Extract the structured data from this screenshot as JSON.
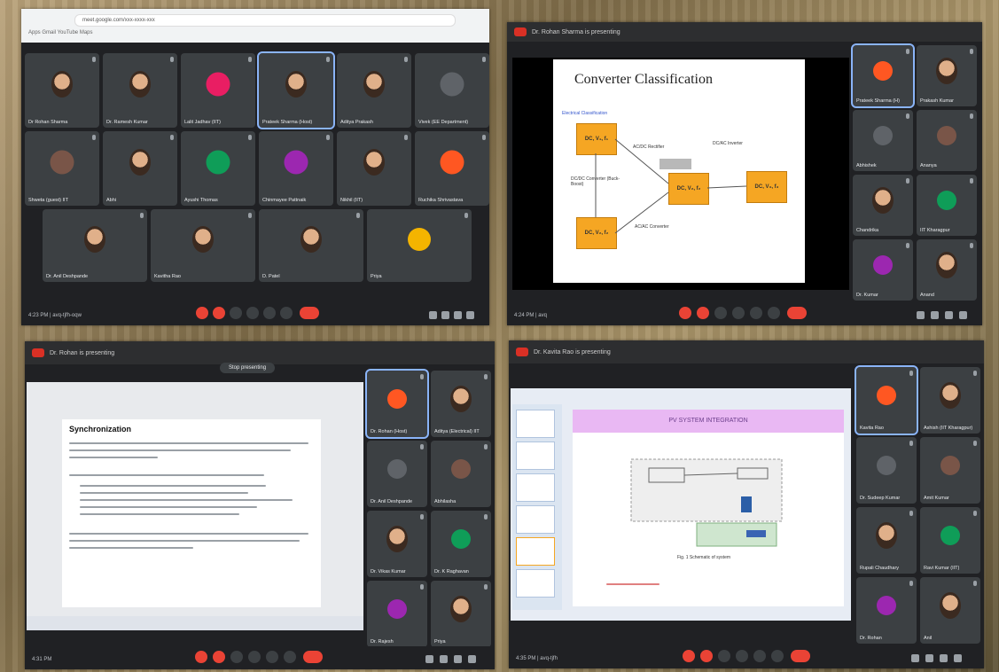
{
  "panel1": {
    "url": "meet.google.com/xxx-xxxx-xxx",
    "bookmarks": "Apps   Gmail   YouTube   Maps",
    "participants": [
      "Dr Rohan Sharma",
      "Dr. Ramesh Kumar",
      "Lalit Jadhav (IIT)",
      "Prateek Sharma (Host)",
      "Aditya Prakash",
      "Vivek (EE Department)",
      "Shweta (guest) IIT",
      "Abhi",
      "Ayushi Thomas",
      "Chinmayee Pattnaik",
      "Nikhil (IIT)",
      "Ruchika Shrivastava",
      "Dr. Anil Deshpande",
      "Kavitha Rao",
      "D. Patel",
      "Priya"
    ],
    "meeting_time": "4:23 PM | avq-tjfh-oqw"
  },
  "panel2": {
    "title": "Dr. Rohan Sharma is presenting",
    "slide_title": "Converter Classification",
    "slide_subtitle": "Electrical Classification",
    "blocks": [
      "DC, V₁, f₁",
      "DC, V₂, f₂",
      "DC, V₂, f₂",
      "DC, V₃, f₃"
    ],
    "labels": [
      "AC/DC Rectifier",
      "DC/DC Converter (Buck-Boost)",
      "DC/AC Inverter",
      "AC/AC Converter",
      "Inverter"
    ],
    "participants": [
      "Prateek Sharma (H)",
      "Prakash Kumar",
      "Abhishek",
      "Ananya",
      "Chandrika",
      "IIT Kharagpur",
      "Dr. Kumar",
      "Anand"
    ],
    "meeting_time": "4:24 PM | avq"
  },
  "panel3": {
    "title": "Dr. Rohan is presenting",
    "present_hint": "Stop presenting",
    "doc_heading": "Synchronization",
    "participants": [
      "Dr. Rohan (Host)",
      "Aditya (Electrical) IIT",
      "Dr. Anil Deshpande",
      "Abhilasha",
      "Dr. Vikas Kumar",
      "Dr. K Raghavan",
      "Dr. Rajesh",
      "Priya"
    ],
    "meeting_time": "4:31 PM"
  },
  "panel4": {
    "title": "Dr. Kavita Rao is presenting",
    "slide_banner": "PV SYSTEM INTEGRATION",
    "figure_caption": "Fig. 1 Schematic of system",
    "participants": [
      "Kavita Rao",
      "Ashish (IIT Kharagpur)",
      "Dr. Sudeep Kumar",
      "Amit Kumar",
      "Rupali Chaudhary",
      "Ravi Kumar (IIT)",
      "Dr. Rohan",
      "Anil"
    ],
    "meeting_time": "4:35 PM | avq-tjfh"
  },
  "colors": {
    "meet_bg": "#202124",
    "tile_bg": "#3c4043",
    "end_call": "#ea4335",
    "highlight": "#8ab4f8",
    "slide_box": "#f5a623"
  }
}
